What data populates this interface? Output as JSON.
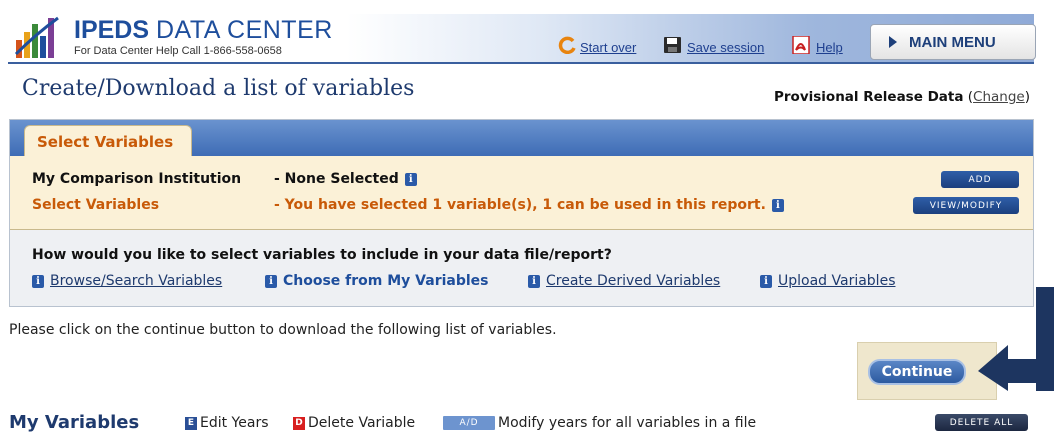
{
  "header": {
    "brand_primary": "IPEDS",
    "brand_secondary": "DATA CENTER",
    "help_line": "For Data Center Help Call 1-866-558-0658",
    "start_over": "Start over",
    "save_session": "Save session",
    "help": "Help",
    "main_menu": "MAIN MENU"
  },
  "page": {
    "title": "Create/Download a list of variables",
    "release_label": "Provisional Release Data",
    "release_change": "Change"
  },
  "panel": {
    "tab": "Select Variables",
    "rows": [
      {
        "label": "My Comparison Institution",
        "value": "- None Selected",
        "button": "ADD"
      },
      {
        "label": "Select Variables",
        "value": "- You have selected 1 variable(s), 1 can be used in this report.",
        "button": "VIEW/MODIFY"
      }
    ],
    "question": "How would you like to select variables to include in your data file/report?",
    "options": [
      "Browse/Search Variables",
      "Choose from My Variables",
      "Create Derived Variables",
      "Upload Variables"
    ]
  },
  "instruction": "Please click on the continue button to download the following list of variables.",
  "continue_label": "Continue",
  "my_variables": {
    "title": "My Variables",
    "edit_years": "Edit Years",
    "delete_variable": "Delete Variable",
    "ad_badge": "A/D",
    "modify_years": "Modify years for all variables in a file",
    "delete_all": "DELETE ALL",
    "edit_icon_letter": "E",
    "delete_icon_letter": "D"
  },
  "colors": {
    "accent_blue": "#1e4e9c",
    "orange": "#c85a08",
    "panel_yellow": "#fbf1d7",
    "arrow_navy": "#1d3560"
  }
}
